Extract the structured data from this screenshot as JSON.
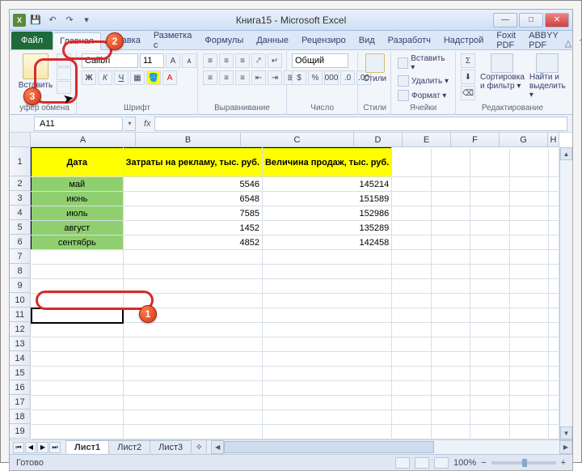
{
  "window": {
    "title": "Книга15  -  Microsoft Excel",
    "app_icon_letter": "X"
  },
  "qat": {
    "save": "💾",
    "undo": "↶",
    "redo": "↷",
    "dd": "▾"
  },
  "winbuttons": {
    "min": "—",
    "max": "□",
    "close": "✕"
  },
  "tabs": {
    "file": "Файл",
    "home": "Главная",
    "insert": "Вставка",
    "layout": "Разметка с",
    "formulas": "Формулы",
    "data": "Данные",
    "review": "Рецензиро",
    "view": "Вид",
    "developer": "Разработч",
    "addins": "Надстрой",
    "foxit": "Foxit PDF",
    "abbyy": "ABBYY PDF"
  },
  "ribbon_right": {
    "help": "?",
    "min": "△"
  },
  "ribbon": {
    "clipboard": {
      "paste": "Вставить",
      "group": "уфер обмена"
    },
    "font": {
      "name": "Calibri",
      "size": "11",
      "group": "Шрифт",
      "B": "Ж",
      "I": "К",
      "U": "Ч"
    },
    "align": {
      "group": "Выравнивание"
    },
    "number": {
      "format": "Общий",
      "group": "Число"
    },
    "styles": {
      "label": "Стили",
      "group": "Стили"
    },
    "cells": {
      "insert": "Вставить ▾",
      "delete": "Удалить ▾",
      "format": "Формат ▾",
      "group": "Ячейки"
    },
    "editing": {
      "sort": "Сортировка и фильтр ▾",
      "find": "Найти и выделить ▾",
      "group": "Редактирование"
    }
  },
  "namebox": "A11",
  "fx": "fx",
  "columns": [
    "A",
    "B",
    "C",
    "D",
    "E",
    "F",
    "G",
    "H"
  ],
  "row_labels": [
    "1",
    "2",
    "3",
    "4",
    "5",
    "6",
    "7",
    "8",
    "9",
    "10",
    "11",
    "12",
    "13",
    "14",
    "15",
    "16",
    "17",
    "18",
    "19"
  ],
  "headers": {
    "A": "Дата",
    "B": "Затраты на рекламу, тыс. руб.",
    "C": "Величина продаж, тыс. руб."
  },
  "rows": [
    {
      "A": "май",
      "B": "5546",
      "C": "145214"
    },
    {
      "A": "июнь",
      "B": "6548",
      "C": "151589"
    },
    {
      "A": "июль",
      "B": "7585",
      "C": "152986"
    },
    {
      "A": "август",
      "B": "1452",
      "C": "135289"
    },
    {
      "A": "сентябрь",
      "B": "4852",
      "C": "142458"
    }
  ],
  "sheets": {
    "s1": "Лист1",
    "s2": "Лист2",
    "s3": "Лист3"
  },
  "status": {
    "ready": "Готово",
    "zoom": "100%",
    "minus": "−",
    "plus": "+"
  },
  "callout_badges": {
    "b1": "1",
    "b2": "2",
    "b3": "3"
  }
}
